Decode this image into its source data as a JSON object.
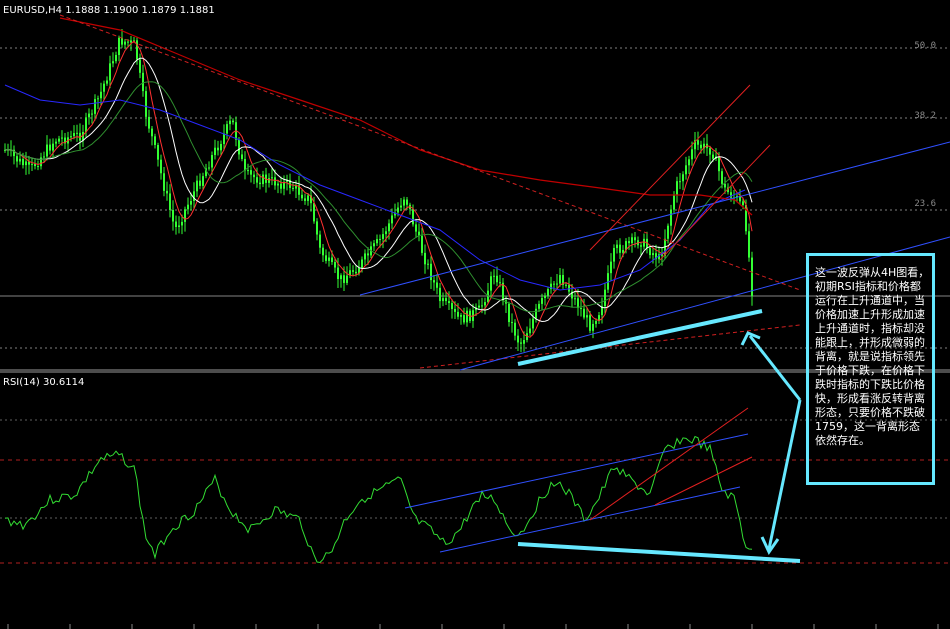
{
  "header": {
    "main": "EURUSD,H4  1.1888 1.1900 1.1879 1.1881",
    "sub": "RSI(14)  30.6114"
  },
  "fib_levels": [
    "50.0",
    "38.2",
    "23.6"
  ],
  "annotation": "这一波反弹从4H图看，初期RSI指标和价格都运行在上升通道中，当价格加速上升形成加速上升通道时，指标却没能跟上，并形成微弱的背离，就是说指标领先于价格下跌，在价格下跌时指标的下跌比价格快，形成看涨反转背离形态，只要价格不跌破1759，这一背离形态依然存在。",
  "colors": {
    "background": "#000000",
    "candles": "#33ff33",
    "ma_fast": "#ff3030",
    "ma_slow_red": "#c00000",
    "ma_blue": "#2828ff",
    "ma_white": "#ffffff",
    "ma_green": "#2f8f2f",
    "rsi_line": "#33dd33",
    "channel": "#3050ff",
    "accel_channel": "#e02020",
    "highlight": "#66e8ff",
    "fib": "#808080"
  },
  "chart_data": [
    {
      "type": "candlestick",
      "title": "EURUSD,H4",
      "last_quote": {
        "open": 1.1888,
        "high": 1.19,
        "low": 1.1879,
        "close": 1.1881
      },
      "overlays": [
        "moving averages",
        "fibonacci retracement 23.6 / 38.2 / 50.0",
        "rising channel",
        "accelerating channel"
      ],
      "trend": "rally from mid lows, accelerating rise, sharp drop at end"
    },
    {
      "type": "line",
      "title": "RSI(14)",
      "last_value": 30.6114,
      "levels": [
        70,
        30
      ]
    }
  ]
}
